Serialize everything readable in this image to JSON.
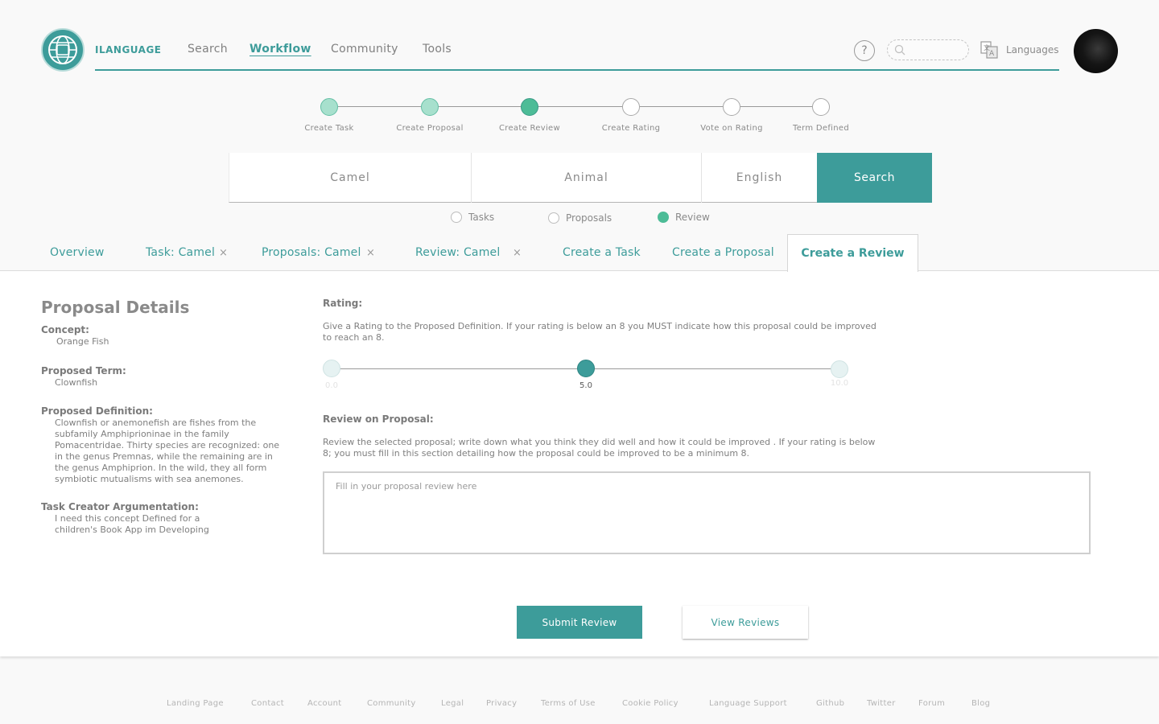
{
  "header": {
    "brand": "ILANGUAGE",
    "nav": [
      {
        "label": "Search",
        "active": false
      },
      {
        "label": "Workflow",
        "active": true
      },
      {
        "label": "Community",
        "active": false
      },
      {
        "label": "Tools",
        "active": false
      }
    ],
    "help": "?",
    "search_placeholder": "",
    "languages_label": "Languages"
  },
  "workflow_steps": [
    {
      "label": "Create Task",
      "state": "done"
    },
    {
      "label": "Create Proposal",
      "state": "done"
    },
    {
      "label": "Create Review",
      "state": "current"
    },
    {
      "label": "Create Rating",
      "state": "pending"
    },
    {
      "label": "Vote on Rating",
      "state": "pending"
    },
    {
      "label": "Term Defined",
      "state": "pending"
    }
  ],
  "search": {
    "term": "Camel",
    "category": "Animal",
    "language": "English",
    "button": "Search"
  },
  "filters": [
    {
      "label": "Tasks",
      "checked": false
    },
    {
      "label": "Proposals",
      "checked": false
    },
    {
      "label": "Review",
      "checked": true
    }
  ],
  "tabs": [
    {
      "label": "Overview",
      "closable": false
    },
    {
      "label": "Task: Camel",
      "closable": true
    },
    {
      "label": "Proposals: Camel",
      "closable": true
    },
    {
      "label": "Review: Camel",
      "closable": true
    },
    {
      "label": "Create a Task",
      "closable": false
    },
    {
      "label": "Create a Proposal",
      "closable": false
    },
    {
      "label": "Create a Review",
      "closable": false,
      "active": true
    }
  ],
  "tab_close_symbol": "×",
  "proposal_details": {
    "title": "Proposal Details",
    "concept_label": "Concept:",
    "concept": "Orange Fish",
    "term_label": "Proposed Term:",
    "term": "Clownfish",
    "definition_label": "Proposed Definition:",
    "definition": "Clownfish or anemonefish are fishes from the subfamily Amphiprioninae in the family Pomacentridae. Thirty species are recognized: one in the genus Premnas, while the remaining are in the genus Amphiprion. In the wild, they all form symbiotic mutualisms with sea anemones.",
    "argumentation_label": "Task Creator Argumentation:",
    "argumentation": "I need this concept Defined for a children's Book App im Developing"
  },
  "rating": {
    "label": "Rating:",
    "instructions": "Give a Rating to the Proposed Definition. If your rating is below an 8 you MUST indicate how this proposal could be improved to reach an 8.",
    "min_label": "0.0",
    "value_label": "5.0",
    "max_label": "10.0",
    "value": 5.0,
    "min": 0,
    "max": 10
  },
  "review": {
    "label": "Review on Proposal:",
    "instructions": "Review the selected proposal; write down what you think they did well and how it could be improved . If your rating is below 8; you must fill in this section detailing how the proposal could be improved to be a minimum 8.",
    "placeholder": "Fill in your proposal review here"
  },
  "actions": {
    "submit": "Submit Review",
    "view": "View Reviews"
  },
  "footer": [
    "Landing Page",
    "Contact",
    "Account",
    "Community",
    "Legal",
    "Privacy",
    "Terms of Use",
    "Cookie Policy",
    "Language Support",
    "Github",
    "Twitter",
    "Forum",
    "Blog"
  ],
  "colors": {
    "accent": "#3d9c9a",
    "step_done": "#a7e0cd",
    "step_current": "#4dbc97"
  }
}
